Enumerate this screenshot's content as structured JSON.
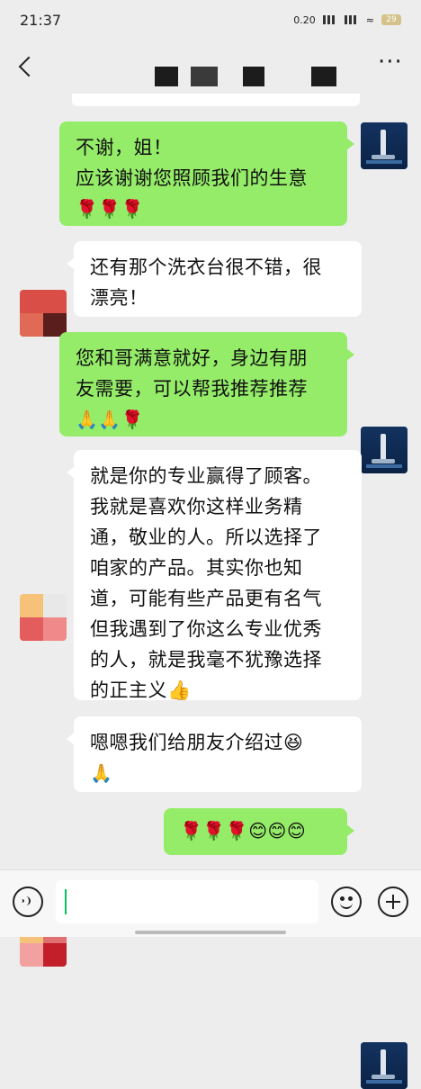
{
  "status_bar": {
    "time": "21:37",
    "speed": "0.20",
    "battery": "29"
  },
  "header": {
    "title": ""
  },
  "messages": [
    {
      "side": "right",
      "lines": [
        "不谢，姐！",
        "应该谢谢您照顾我们的生意",
        "🌹🌹🌹"
      ]
    },
    {
      "side": "left",
      "lines": [
        "还有那个洗衣台很不错，很",
        "漂亮！"
      ]
    },
    {
      "side": "right",
      "lines": [
        "您和哥满意就好，身边有朋",
        "友需要，可以帮我推荐推荐",
        "🙏🙏🌹"
      ]
    },
    {
      "side": "left",
      "lines": [
        "就是你的专业赢得了顾客。",
        "我就是喜欢你这样业务精",
        "通，敬业的人。所以选择了",
        "咱家的产品。其实你也知",
        "道，可能有些产品更有名气",
        "但我遇到了你这么专业优秀",
        "的人，就是我毫不犹豫选择",
        "的正主义👍"
      ]
    },
    {
      "side": "left",
      "lines": [
        "嗯嗯我们给朋友介绍过😆",
        "🙏"
      ]
    },
    {
      "side": "right",
      "lines": [
        "🌹🌹🌹😊😊😊"
      ]
    }
  ],
  "input": {
    "value": "",
    "placeholder": ""
  },
  "colors": {
    "sent_bubble": "#95ec69",
    "received_bubble": "#ffffff",
    "background": "#ededed",
    "caret": "#07c160"
  },
  "icons": [
    "back-icon",
    "more-icon",
    "voice-icon",
    "emoji-icon",
    "plus-icon"
  ]
}
